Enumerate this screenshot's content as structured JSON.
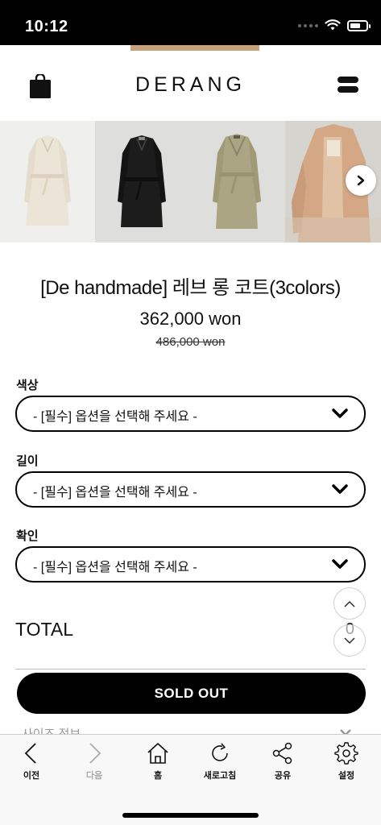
{
  "status_bar": {
    "time": "10:12"
  },
  "header": {
    "logo": "DERANG"
  },
  "gallery": {
    "images": [
      {
        "alt": "ivory-coat"
      },
      {
        "alt": "black-coat"
      },
      {
        "alt": "khaki-coat"
      },
      {
        "alt": "beige-coat-back"
      }
    ]
  },
  "product": {
    "title": "[De handmade] 레브 롱 코트(3colors)",
    "price": "362,000 won",
    "original_price": "486,000 won"
  },
  "options": [
    {
      "label": "색상",
      "placeholder": "- [필수] 옵션을 선택해 주세요 -"
    },
    {
      "label": "길이",
      "placeholder": "- [필수] 옵션을 선택해 주세요 -"
    },
    {
      "label": "확인",
      "placeholder": "- [필수] 옵션을 선택해 주세요 -"
    }
  ],
  "total": {
    "label": "TOTAL",
    "value": "0"
  },
  "buy_button": {
    "label": "SOLD OUT"
  },
  "size_info": {
    "label": "사이즈 정보"
  },
  "bottom_nav": {
    "items": [
      {
        "label": "이전",
        "icon": "chevron-left-icon"
      },
      {
        "label": "다음",
        "icon": "chevron-right-icon"
      },
      {
        "label": "홈",
        "icon": "home-icon"
      },
      {
        "label": "새로고침",
        "icon": "refresh-icon"
      },
      {
        "label": "공유",
        "icon": "share-icon"
      },
      {
        "label": "설정",
        "icon": "gear-icon"
      }
    ]
  },
  "colors": {
    "accent": "#000000",
    "disabled": "#aaaaaa",
    "coat_ivory": "#ede6da",
    "coat_black": "#1b1b1b",
    "coat_khaki": "#a9a27f",
    "coat_beige": "#d4a885"
  }
}
